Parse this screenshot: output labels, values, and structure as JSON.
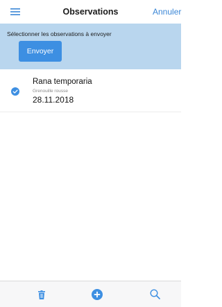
{
  "navbar": {
    "title": "Observations",
    "cancel_label": "Annuler"
  },
  "banner": {
    "text": "Sélectionner les observations à envoyer",
    "send_label": "Envoyer"
  },
  "observations": [
    {
      "name": "Rana temporaria",
      "common_name": "Grenouille rousse",
      "date": "28.11.2018",
      "selected": true
    }
  ],
  "toolbar": {
    "icons": [
      "trash-icon",
      "add-icon",
      "search-icon"
    ]
  },
  "colors": {
    "accent": "#3d8fe2",
    "banner_bg": "#b9d6ee",
    "link": "#3a86d6"
  }
}
